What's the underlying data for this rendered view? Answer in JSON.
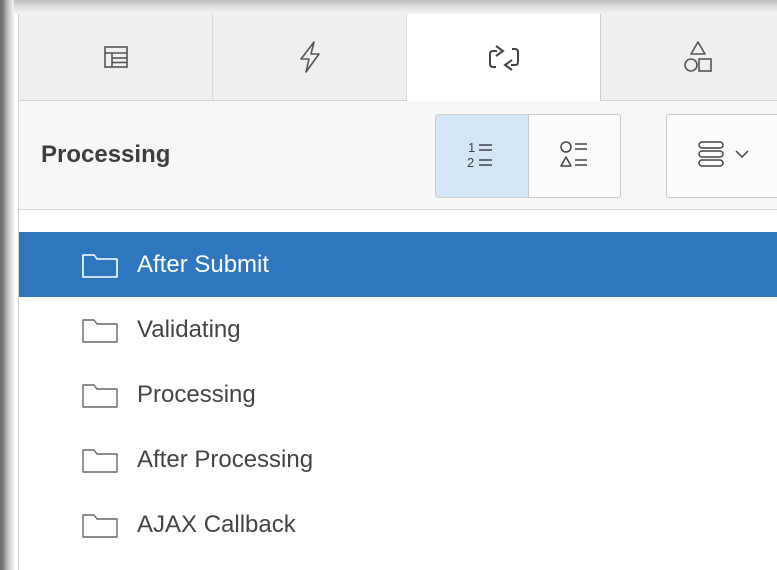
{
  "tabs": [
    {
      "id": "rendering",
      "icon": "layout-icon",
      "active": false
    },
    {
      "id": "dynamic-actions",
      "icon": "lightning-icon",
      "active": false
    },
    {
      "id": "processing",
      "icon": "processing-icon",
      "active": true
    },
    {
      "id": "shared-components",
      "icon": "shapes-icon",
      "active": false
    }
  ],
  "toolbar": {
    "title": "Processing",
    "view_modes": [
      {
        "id": "execution-order",
        "icon": "numbered-list-icon",
        "selected": true
      },
      {
        "id": "group-by-type",
        "icon": "shape-list-icon",
        "selected": false
      }
    ],
    "menu_icon": "stack-menu-icon"
  },
  "tree": {
    "items": [
      {
        "label": "After Submit",
        "icon": "folder-icon",
        "selected": true
      },
      {
        "label": "Validating",
        "icon": "folder-icon",
        "selected": false
      },
      {
        "label": "Processing",
        "icon": "folder-icon",
        "selected": false
      },
      {
        "label": "After Processing",
        "icon": "folder-icon",
        "selected": false
      },
      {
        "label": "AJAX Callback",
        "icon": "folder-icon",
        "selected": false
      }
    ]
  },
  "colors": {
    "selected_row": "#2e76bd",
    "toggle_on": "#d3e6f8",
    "tab_bar": "#efefef",
    "text": "#444444"
  }
}
